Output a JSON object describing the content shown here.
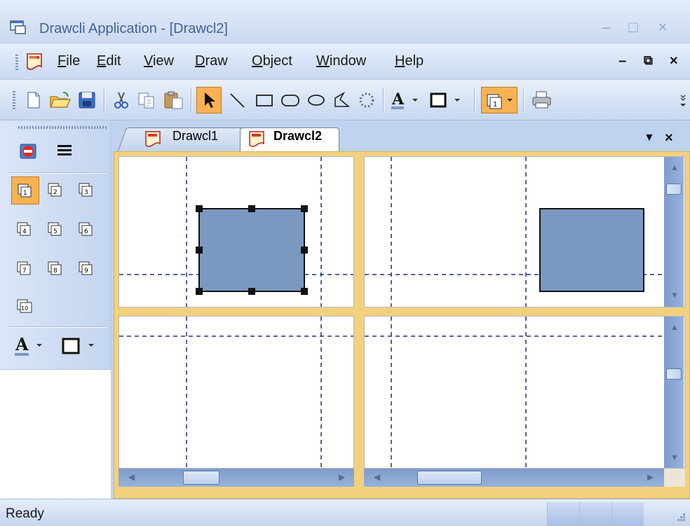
{
  "window": {
    "title": "Drawcli Application - [Drawcl2]",
    "icon": "app-window-icon",
    "buttons": [
      "minimize-icon",
      "restore-icon",
      "close-icon"
    ]
  },
  "menubar": {
    "items": [
      {
        "label": "File",
        "accel": "F"
      },
      {
        "label": "Edit",
        "accel": "E"
      },
      {
        "label": "View",
        "accel": "V"
      },
      {
        "label": "Draw",
        "accel": "D"
      },
      {
        "label": "Object",
        "accel": "O"
      },
      {
        "label": "Window",
        "accel": "W"
      },
      {
        "label": "Help",
        "accel": "H"
      }
    ],
    "mdi_buttons": [
      "minimize-icon",
      "restore-icon",
      "close-icon"
    ]
  },
  "toolbar": {
    "buttons": [
      "new-icon",
      "open-icon",
      "save-icon",
      "cut-icon",
      "copy-icon",
      "paste-icon",
      "select-arrow-icon",
      "line-icon",
      "rectangle-icon",
      "rounded-rectangle-icon",
      "ellipse-icon",
      "polygon-icon",
      "dotted-circle-icon",
      "font-color-icon",
      "border-color-icon",
      "object-order-icon",
      "print-icon"
    ],
    "active": "select-arrow-icon"
  },
  "palette": {
    "top_icons": [
      "stop-icon",
      "line-style-icon"
    ],
    "numbered_buttons": [
      "1",
      "2",
      "3",
      "4",
      "5",
      "6",
      "7",
      "8",
      "9",
      "10"
    ],
    "active": "1",
    "bottom_icons": [
      "font-color-icon",
      "border-color-icon"
    ]
  },
  "tabs": [
    {
      "label": "Drawcl1",
      "active": false
    },
    {
      "label": "Drawcl2",
      "active": true
    }
  ],
  "status": {
    "text": "Ready"
  },
  "colors": {
    "shape_fill": "#7b98c1",
    "accent_orange": "#f8b253",
    "frame_gold": "#f2d17e",
    "grid_line": "#1c2e8a"
  }
}
